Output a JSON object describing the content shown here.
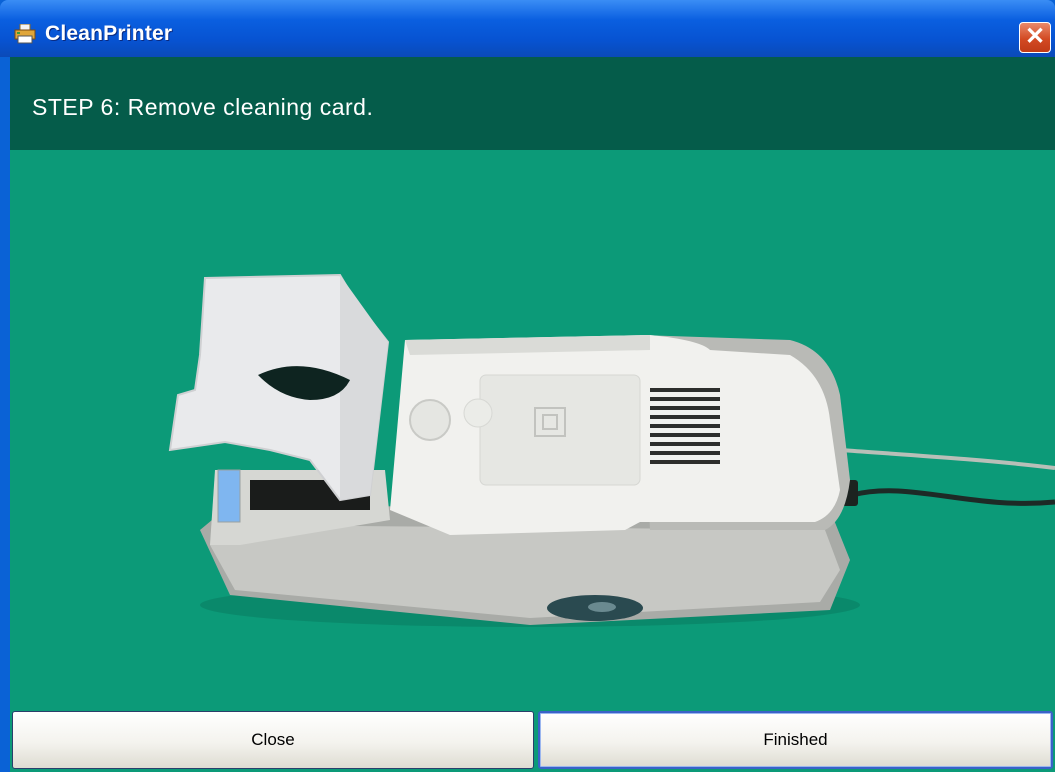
{
  "window": {
    "title": "CleanPrinter",
    "icon": "app-printer-icon",
    "close_glyph": "✕"
  },
  "step": {
    "instruction": "STEP 6:  Remove cleaning card."
  },
  "illustration": {
    "subject": "printer-with-cleaning-card-image"
  },
  "buttons": {
    "close_label": "Close",
    "finished_label": "Finished"
  },
  "colors": {
    "titlebar": "#0a5fe0",
    "step_band": "#055c4a",
    "background": "#0c9a78",
    "close_button": "#d34a23"
  }
}
